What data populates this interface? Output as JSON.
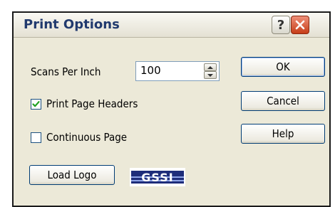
{
  "window": {
    "title": "Print Options",
    "help_button_label": "?"
  },
  "form": {
    "scans_label": "Scans Per Inch",
    "scans_value": "100",
    "print_headers_label": "Print Page Headers",
    "print_headers_checked": true,
    "continuous_page_label": "Continuous Page",
    "continuous_page_checked": false
  },
  "buttons": {
    "ok": "OK",
    "cancel": "Cancel",
    "help": "Help",
    "load_logo": "Load Logo"
  },
  "logo": {
    "text": "GSSI"
  },
  "colors": {
    "dialog_bg": "#ece9d8",
    "title_text": "#213a6e",
    "button_border": "#003c74",
    "check_mark": "#21a121",
    "close_button": "#c63d18"
  }
}
